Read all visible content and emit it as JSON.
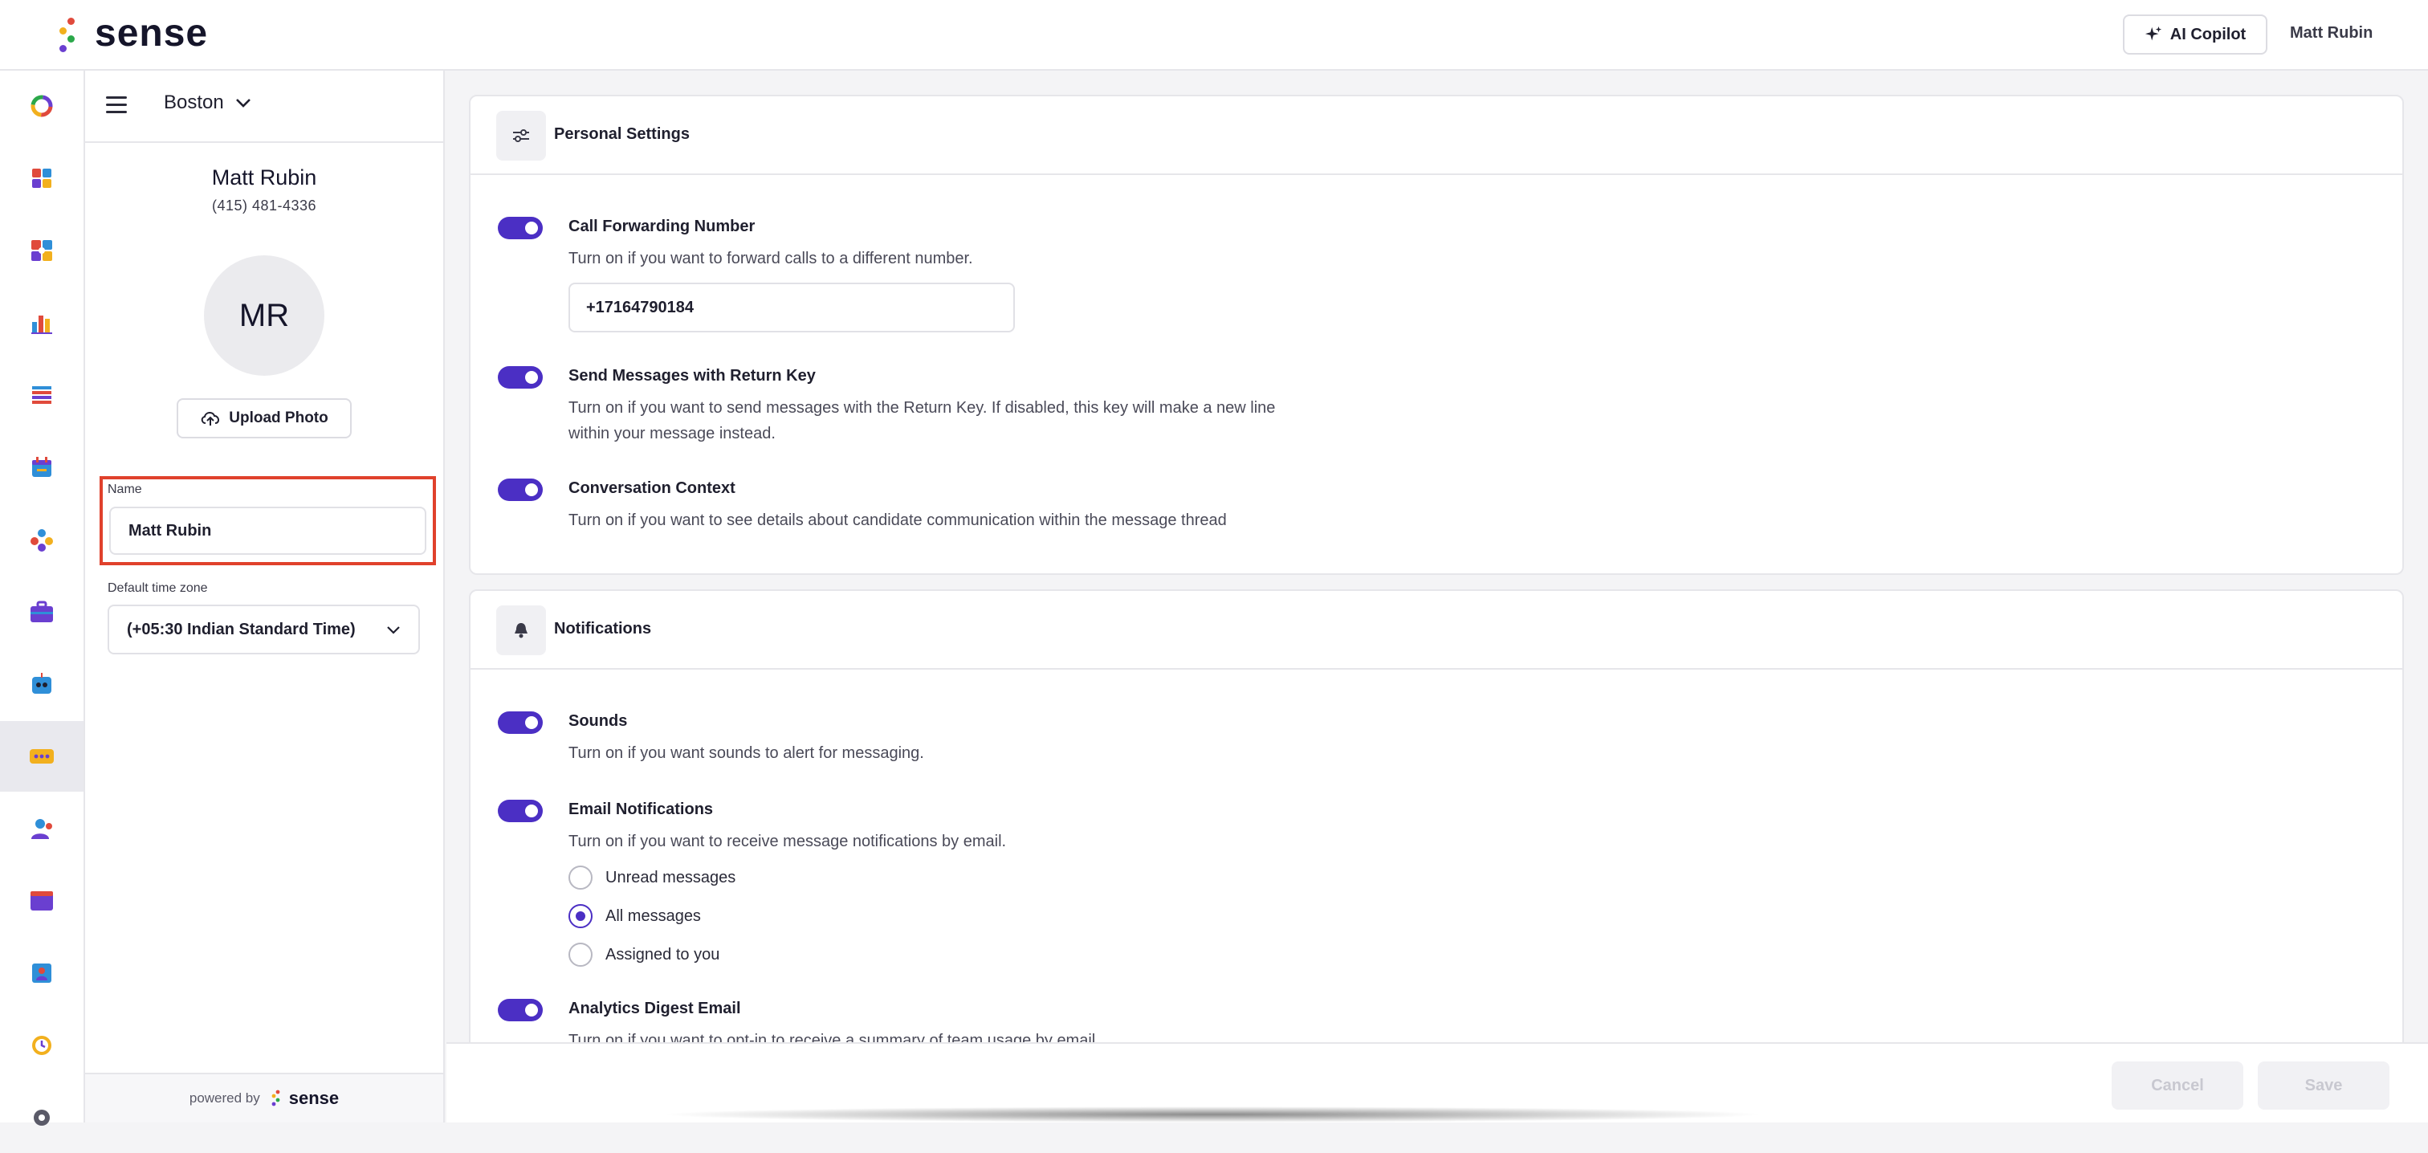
{
  "app": {
    "brand": "sense",
    "copilot_label": "AI Copilot",
    "user_name": "Matt Rubin"
  },
  "sidebar_icons": [
    "ring-chart-icon",
    "dashboard-grid-icon",
    "puzzle-icon",
    "bar-chart-icon",
    "list-icon",
    "calendar-icon",
    "people-network-icon",
    "briefcase-icon",
    "robot-icon",
    "chat-bubble-icon",
    "user-icon",
    "browser-window-icon",
    "contact-card-icon",
    "clock-icon",
    "gear-icon"
  ],
  "left_panel": {
    "location": "Boston",
    "profile_name": "Matt Rubin",
    "phone": "(415) 481-4336",
    "avatar_initials": "MR",
    "upload_label": "Upload Photo",
    "name_label": "Name",
    "name_value": "Matt Rubin",
    "timezone_label": "Default time zone",
    "timezone_value": "(+05:30 Indian Standard Time)",
    "powered_by": "powered by",
    "powered_brand": "sense"
  },
  "personal_settings": {
    "title": "Personal Settings",
    "items": [
      {
        "title": "Call Forwarding Number",
        "desc": "Turn on if you want to forward calls to a different number.",
        "enabled": true,
        "input_value": "+17164790184"
      },
      {
        "title": "Send Messages with Return Key",
        "desc_line1": "Turn on if you want to send messages with the Return Key. If disabled, this key will make a new line",
        "desc_line2": "within your message instead.",
        "enabled": true
      },
      {
        "title": "Conversation Context",
        "desc": "Turn on if you want to see details about candidate communication within the message thread",
        "enabled": true
      }
    ]
  },
  "notifications": {
    "title": "Notifications",
    "sounds": {
      "title": "Sounds",
      "desc": "Turn on if you want sounds to alert for messaging.",
      "enabled": true
    },
    "email": {
      "title": "Email Notifications",
      "desc": "Turn on if you want to receive message notifications by email.",
      "enabled": true,
      "options": [
        "Unread messages",
        "All messages",
        "Assigned to you"
      ],
      "selected": "All messages"
    },
    "analytics": {
      "title": "Analytics Digest Email",
      "desc": "Turn on if you want to opt-in to receive a summary of team usage by email.",
      "enabled": true
    }
  },
  "footer": {
    "cancel_label": "Cancel",
    "save_label": "Save"
  },
  "colors": {
    "accent": "#4b2fc4",
    "highlight_border": "#e0412c"
  }
}
